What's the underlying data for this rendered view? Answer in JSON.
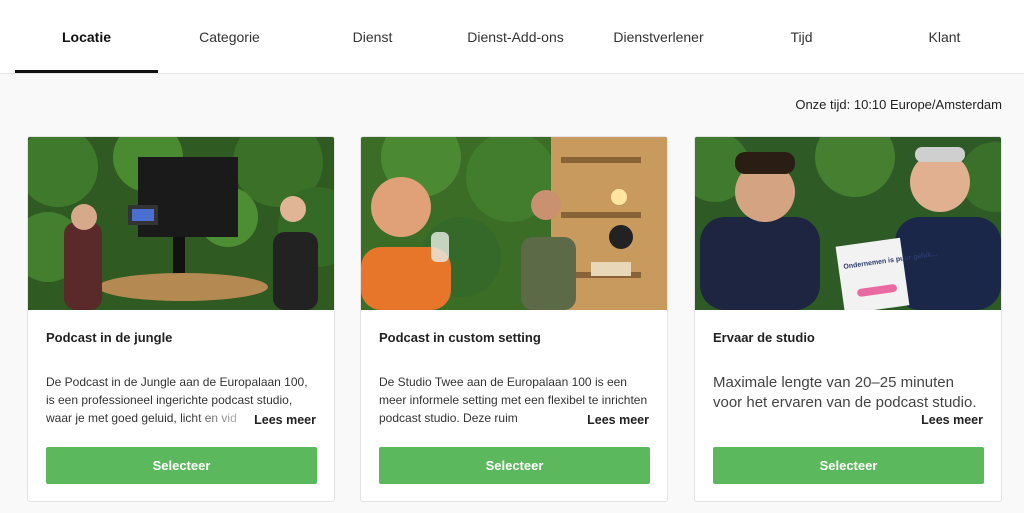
{
  "tabs": [
    {
      "label": "Locatie",
      "active": true
    },
    {
      "label": "Categorie"
    },
    {
      "label": "Dienst"
    },
    {
      "label": "Dienst-Add-ons"
    },
    {
      "label": "Dienstverlener"
    },
    {
      "label": "Tijd"
    },
    {
      "label": "Klant"
    }
  ],
  "timezone": "Onze tijd: 10:10 Europe/Amsterdam",
  "cards": [
    {
      "title": "Podcast in de jungle",
      "description": "De Podcast in de Jungle aan de Europalaan 100, is een professioneel ingerichte podcast studio, waar je met goed geluid, licht en vid",
      "read_more": "Lees meer",
      "button": "Selecteer"
    },
    {
      "title": "Podcast in custom setting",
      "description": "De Studio Twee aan de Europalaan 100 is een meer informele setting met een flexibel te inrichten podcast studio. Deze ruim",
      "read_more": "Lees meer",
      "button": "Selecteer"
    },
    {
      "title": "Ervaar de studio",
      "description": "Maximale lengte van 20–25 minuten voor het ervaren van de podcast studio.",
      "read_more": "Lees meer",
      "button": "Selecteer",
      "image_text": "Ondernemen is puur geluk..."
    }
  ],
  "colors": {
    "accent": "#5cb85c",
    "active_tab_underline": "#111111"
  }
}
